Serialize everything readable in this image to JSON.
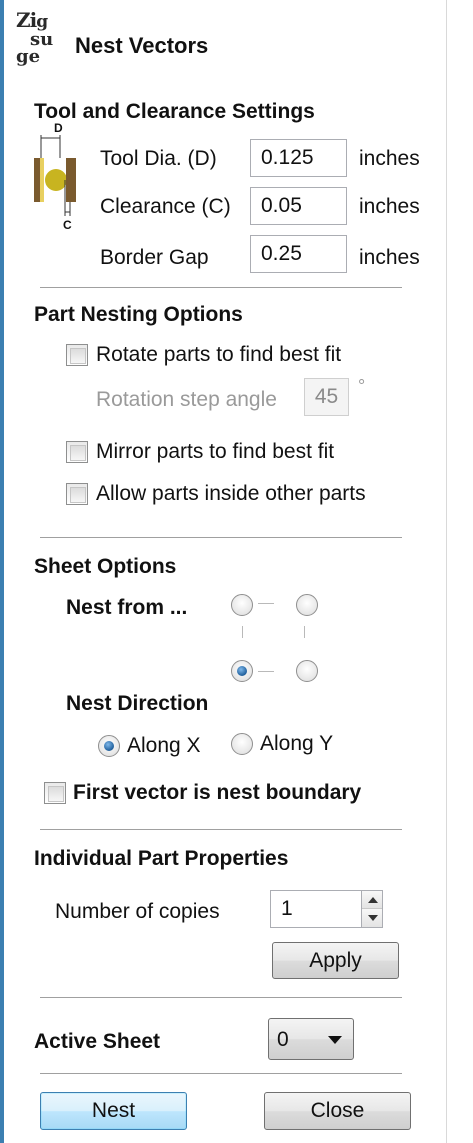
{
  "header": {
    "logo_text": "Zigsu\nge",
    "title": "Nest Vectors"
  },
  "tool_clearance": {
    "heading": "Tool and Clearance Settings",
    "diagram": {
      "top_letter": "D",
      "bottom_letter": "C"
    },
    "tool_dia_label": "Tool Dia. (D)",
    "tool_dia_value": "0.125",
    "tool_dia_unit": "inches",
    "clearance_label": "Clearance (C)",
    "clearance_value": "0.05",
    "clearance_unit": "inches",
    "border_gap_label": "Border Gap",
    "border_gap_value": "0.25",
    "border_gap_unit": "inches"
  },
  "part_nesting": {
    "heading": "Part Nesting Options",
    "rotate_label": "Rotate parts to find best fit",
    "rotate_checked": false,
    "rotation_step_label": "Rotation step angle",
    "rotation_step_value": "45",
    "rotation_step_unit": "°",
    "mirror_label": "Mirror parts to find best fit",
    "mirror_checked": false,
    "allow_inside_label": "Allow parts inside other parts",
    "allow_inside_checked": false
  },
  "sheet_options": {
    "heading": "Sheet Options",
    "nest_from_label": "Nest from ...",
    "nest_from_selected": "bottom-left",
    "nest_direction_label": "Nest Direction",
    "along_x_label": "Along X",
    "along_y_label": "Along Y",
    "nest_direction_selected": "Along X",
    "first_vector_label": "First vector is nest boundary",
    "first_vector_checked": false
  },
  "part_properties": {
    "heading": "Individual Part Properties",
    "copies_label": "Number of copies",
    "copies_value": "1",
    "apply_label": "Apply"
  },
  "active_sheet": {
    "label": "Active Sheet",
    "value": "0"
  },
  "footer": {
    "nest_label": "Nest",
    "close_label": "Close"
  },
  "colors": {
    "accent": "#3c7fb1",
    "tool_yellow": "#c8b420",
    "tool_brown": "#7a5a2e"
  }
}
